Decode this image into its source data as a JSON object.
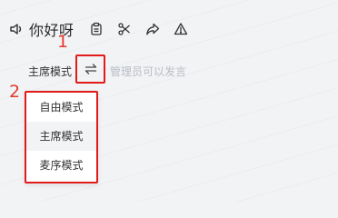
{
  "toolbar": {
    "speaker_icon": "speaker-icon",
    "title": "你好呀",
    "buttons": [
      {
        "icon": "clipboard-icon"
      },
      {
        "icon": "scissors-icon"
      },
      {
        "icon": "share-arrow-icon"
      },
      {
        "icon": "warning-icon"
      }
    ]
  },
  "mode": {
    "current_label": "主席模式",
    "switch_icon": "swap-icon",
    "hint": "管理员可以发言"
  },
  "annotations": {
    "marker_1": "1",
    "marker_2": "2"
  },
  "menu": {
    "items": [
      {
        "label": "自由模式"
      },
      {
        "label": "主席模式",
        "selected": true
      },
      {
        "label": "麦序模式"
      }
    ]
  },
  "colors": {
    "highlight_border": "#e11a1a",
    "annotation_number": "#e33a2e",
    "hint_text": "#b8bcc4",
    "background": "#f2f3f5"
  }
}
